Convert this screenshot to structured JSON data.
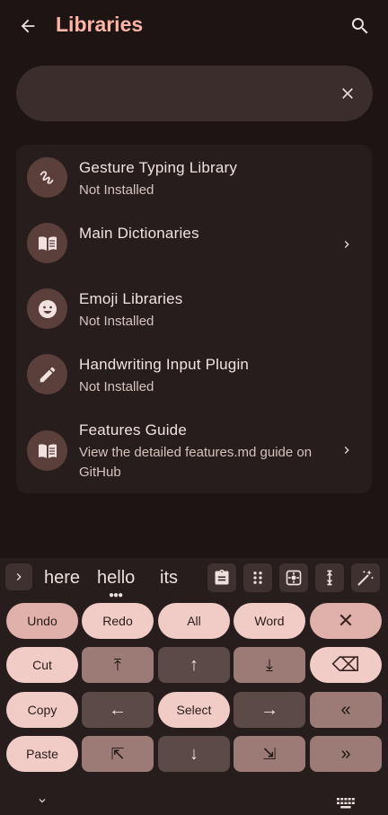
{
  "appbar": {
    "title": "Libraries",
    "back_icon": "arrow-back-icon",
    "search_icon": "search-icon"
  },
  "search": {
    "value": "",
    "placeholder": "",
    "clear_icon": "close-icon"
  },
  "items": [
    {
      "title": "Gesture Typing Library",
      "subtitle": "Not Installed",
      "icon": "gesture-icon",
      "chevron": false
    },
    {
      "title": "Main Dictionaries",
      "subtitle": "",
      "icon": "book-icon",
      "chevron": true
    },
    {
      "title": "Emoji Libraries",
      "subtitle": "Not Installed",
      "icon": "emoji-icon",
      "chevron": false
    },
    {
      "title": "Handwriting Input Plugin",
      "subtitle": "Not Installed",
      "icon": "pencil-icon",
      "chevron": false
    },
    {
      "title": "Features Guide",
      "subtitle": "View the detailed features.md guide on GitHub",
      "icon": "book-icon",
      "chevron": true
    }
  ],
  "keyboard": {
    "suggestions": [
      "here",
      "hello",
      "its"
    ],
    "tools": [
      "clipboard-icon",
      "apps-grid-icon",
      "select-target-icon",
      "text-cursor-icon",
      "magic-wand-icon"
    ],
    "rows": [
      [
        "Undo",
        "Redo",
        "All",
        "Word",
        "✕"
      ],
      [
        "Cut",
        "⤒",
        "↑",
        "⤓",
        "⌫"
      ],
      [
        "Copy",
        "←",
        "Select",
        "→",
        "«"
      ],
      [
        "Paste",
        "⇱",
        "↓",
        "⇲",
        "»"
      ]
    ]
  },
  "colors": {
    "accent": "#ffb4a6",
    "background": "#1d1413",
    "card": "#271d1c"
  }
}
